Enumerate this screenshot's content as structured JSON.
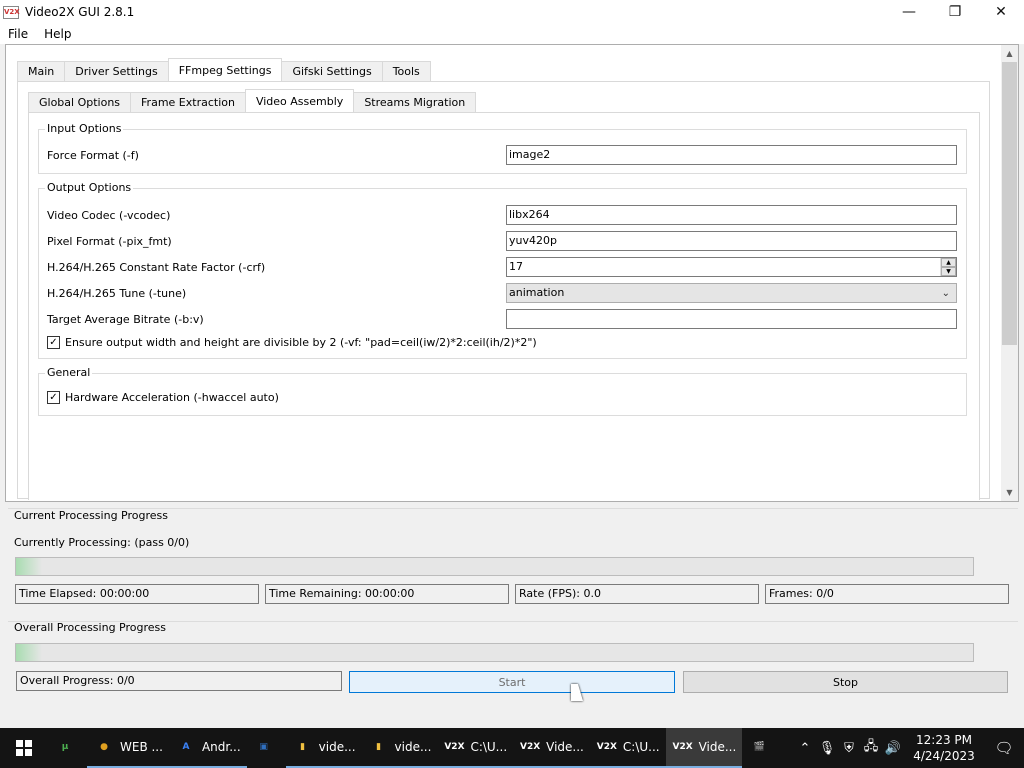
{
  "window": {
    "title": "Video2X GUI 2.8.1",
    "icon_text": "V2X",
    "minimize": "—",
    "maximize": "❐",
    "close": "✕"
  },
  "menu": [
    "File",
    "Help"
  ],
  "main_tabs": [
    {
      "label": "Main",
      "active": false
    },
    {
      "label": "Driver Settings",
      "active": false
    },
    {
      "label": "FFmpeg Settings",
      "active": true
    },
    {
      "label": "Gifski Settings",
      "active": false
    },
    {
      "label": "Tools",
      "active": false
    }
  ],
  "sub_tabs": [
    {
      "label": "Global Options",
      "active": false
    },
    {
      "label": "Frame Extraction",
      "active": false
    },
    {
      "label": "Video Assembly",
      "active": true
    },
    {
      "label": "Streams Migration",
      "active": false
    }
  ],
  "input_options": {
    "title": "Input Options",
    "force_format_label": "Force Format (-f)",
    "force_format_value": "image2"
  },
  "output_options": {
    "title": "Output Options",
    "video_codec_label": "Video Codec (-vcodec)",
    "video_codec_value": "libx264",
    "pixel_format_label": "Pixel Format (-pix_fmt)",
    "pixel_format_value": "yuv420p",
    "crf_label": "H.264/H.265 Constant Rate Factor (-crf)",
    "crf_value": "17",
    "tune_label": "H.264/H.265 Tune (-tune)",
    "tune_value": "animation",
    "bitrate_label": "Target Average Bitrate (-b:v)",
    "bitrate_value": "",
    "divisible_label": "Ensure output width and height are divisible by 2 (-vf: \"pad=ceil(iw/2)*2:ceil(ih/2)*2\")",
    "divisible_checked": true
  },
  "general": {
    "title": "General",
    "hwaccel_label": "Hardware Acceleration (-hwaccel auto)",
    "hwaccel_checked": true
  },
  "current_progress": {
    "title": "Current Processing Progress",
    "processing_label": "Currently Processing:  (pass 0/0)",
    "fraction": 0.0,
    "time_elapsed": "Time Elapsed: 00:00:00",
    "time_remaining": "Time Remaining: 00:00:00",
    "rate": "Rate (FPS): 0.0",
    "frames": "Frames: 0/0"
  },
  "overall_progress": {
    "title": "Overall Processing Progress",
    "fraction": 0.0,
    "overall_label": "Overall Progress: 0/0",
    "start_label": "Start",
    "stop_label": "Stop"
  },
  "taskbar": {
    "items": [
      {
        "label": "",
        "icon": "µ",
        "color": "#4caf50",
        "state": ""
      },
      {
        "label": "WEB ...",
        "icon": "●",
        "color": "#e0a020",
        "state": "open"
      },
      {
        "label": "Andr...",
        "icon": "A",
        "color": "#3b82f6",
        "state": "open"
      },
      {
        "label": "",
        "icon": "▣",
        "color": "#2f6fbf",
        "state": ""
      },
      {
        "label": "vide...",
        "icon": "▮",
        "color": "#f0c040",
        "state": "open"
      },
      {
        "label": "vide...",
        "icon": "▮",
        "color": "#f0c040",
        "state": "open"
      },
      {
        "label": "C:\\U...",
        "icon": "V2X",
        "color": "#ffffff",
        "state": "open"
      },
      {
        "label": "Vide...",
        "icon": "V2X",
        "color": "#ffffff",
        "state": "open"
      },
      {
        "label": "C:\\U...",
        "icon": "V2X",
        "color": "#ffffff",
        "state": "open"
      },
      {
        "label": "Vide...",
        "icon": "V2X",
        "color": "#ffffff",
        "state": "active"
      },
      {
        "label": "",
        "icon": "🎬",
        "color": "#ffffff",
        "state": ""
      }
    ],
    "time": "12:23 PM",
    "date": "4/24/2023"
  }
}
